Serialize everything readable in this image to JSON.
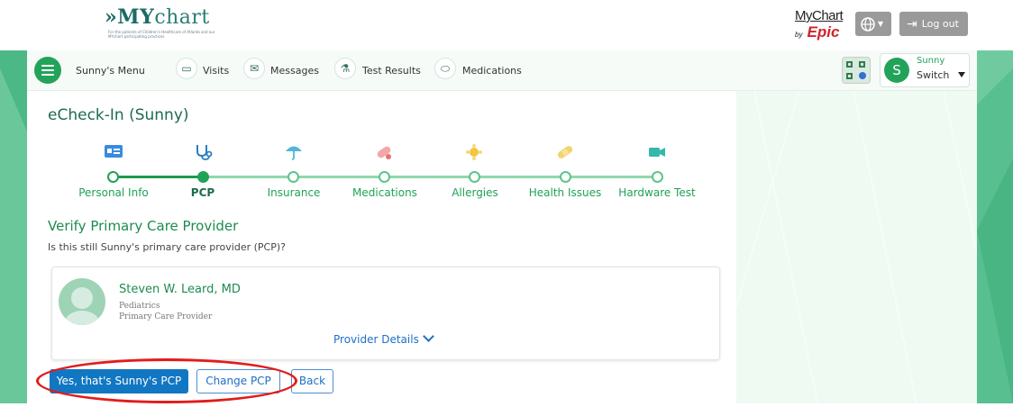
{
  "header": {
    "logo_main": "»MY",
    "logo_thin": "chart",
    "logo_tagline": "For the patients of Children's Healthcare of Atlanta and our MYchart participating practices",
    "epic_my": "MyChart",
    "epic_by": "by",
    "epic_name": "Epic",
    "globe_icon": "globe-icon",
    "logout_label": "Log out"
  },
  "nav": {
    "menu_label": "Sunny's Menu",
    "items": [
      {
        "label": "Visits",
        "icon": "calendar-icon"
      },
      {
        "label": "Messages",
        "icon": "envelope-icon"
      },
      {
        "label": "Test Results",
        "icon": "flask-icon"
      },
      {
        "label": "Medications",
        "icon": "pills-icon"
      }
    ],
    "switch_name": "Sunny",
    "switch_label": "Switch",
    "avatar_letter": "S"
  },
  "page": {
    "title": "eCheck-In (Sunny)",
    "steps": [
      {
        "label": "Personal Info",
        "icon": "id-card-icon",
        "status": "done"
      },
      {
        "label": "PCP",
        "icon": "stethoscope-icon",
        "status": "current"
      },
      {
        "label": "Insurance",
        "icon": "umbrella-icon",
        "status": "todo"
      },
      {
        "label": "Medications",
        "icon": "pill-icon",
        "status": "todo"
      },
      {
        "label": "Allergies",
        "icon": "pollen-icon",
        "status": "todo"
      },
      {
        "label": "Health Issues",
        "icon": "bandage-icon",
        "status": "todo"
      },
      {
        "label": "Hardware Test",
        "icon": "video-camera-icon",
        "status": "todo"
      }
    ],
    "section_title": "Verify Primary Care Provider",
    "question": "Is this still Sunny's primary care provider (PCP)?"
  },
  "provider": {
    "name": "Steven W. Leard, MD",
    "specialty": "Pediatrics",
    "role": "Primary Care Provider",
    "details_link": "Provider Details"
  },
  "actions": {
    "confirm": "Yes, that's Sunny's PCP",
    "change": "Change PCP",
    "back": "Back"
  },
  "colors": {
    "accent_green": "#20a255",
    "primary_blue": "#1277c2",
    "annotation_red": "#e21c1c"
  }
}
